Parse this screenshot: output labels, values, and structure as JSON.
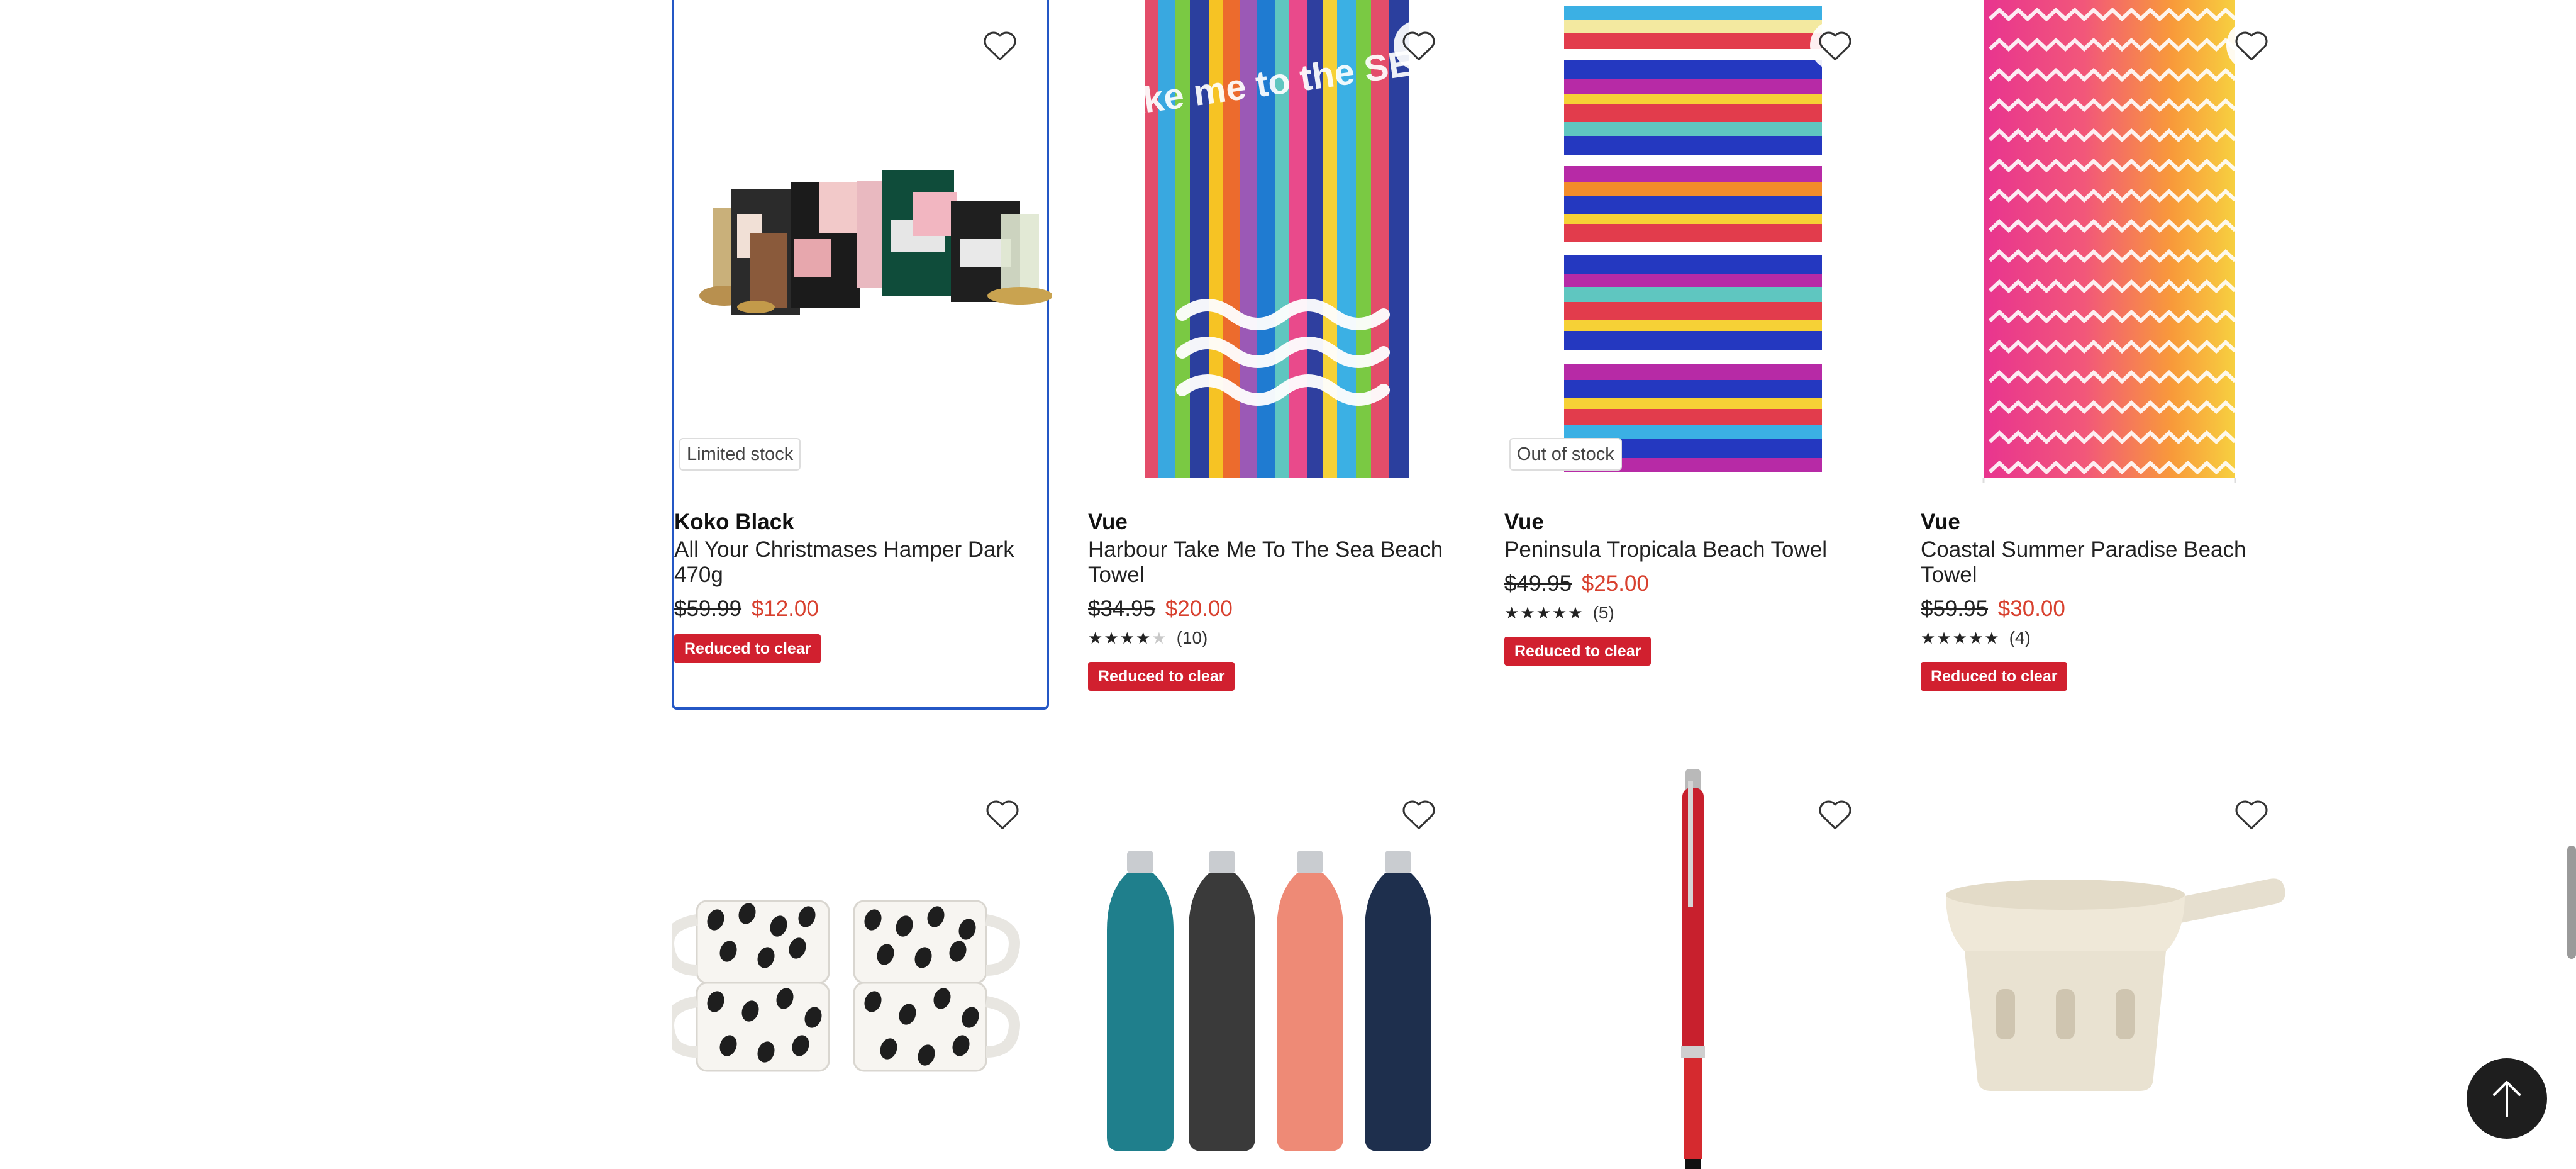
{
  "products": [
    {
      "brand": "Koko Black",
      "name": "All Your Christmases Hamper Dark 470g",
      "was_price": "$59.99",
      "now_price": "$12.00",
      "stock_label": "Limited stock",
      "badge": "Reduced to clear",
      "rating": null,
      "review_count": ""
    },
    {
      "brand": "Vue",
      "name": "Harbour Take Me To The Sea Beach Towel",
      "was_price": "$34.95",
      "now_price": "$20.00",
      "stock_label": "",
      "badge": "Reduced to clear",
      "rating": 3.5,
      "review_count": "(10)",
      "towel_text": "take me to the SEA"
    },
    {
      "brand": "Vue",
      "name": "Peninsula Tropicala Beach Towel",
      "was_price": "$49.95",
      "now_price": "$25.00",
      "stock_label": "Out of stock",
      "badge": "Reduced to clear",
      "rating": 5,
      "review_count": "(5)"
    },
    {
      "brand": "Vue",
      "name": "Coastal Summer Paradise Beach Towel",
      "was_price": "$59.95",
      "now_price": "$30.00",
      "stock_label": "",
      "badge": "Reduced to clear",
      "rating": 5,
      "review_count": "(4)"
    }
  ],
  "icons": {
    "favourite": "heart-outline-icon",
    "back_to_top": "arrow-up-icon"
  },
  "colors": {
    "sale_price": "#d8402e",
    "badge_bg": "#d1202f",
    "selected_border": "#2457c5"
  }
}
